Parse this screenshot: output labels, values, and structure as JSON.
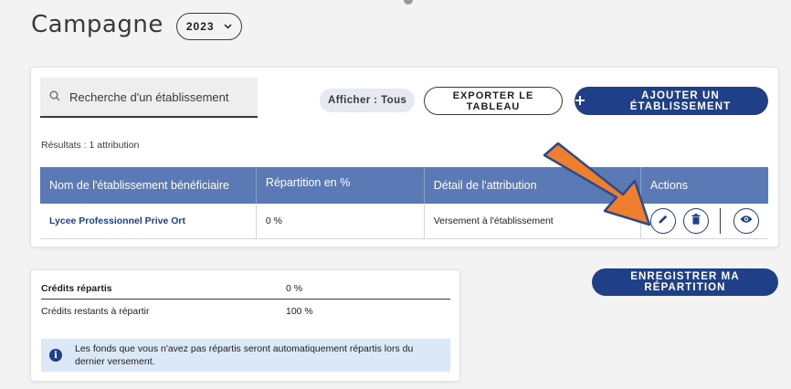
{
  "header": {
    "title": "Campagne",
    "year": "2023",
    "year_chevron": "⌄"
  },
  "toolbar": {
    "search_placeholder": "Recherche d'un établissement",
    "filter_label": "Afficher : Tous",
    "export_label": "EXPORTER LE TABLEAU",
    "add_label": "AJOUTER UN ÉTABLISSEMENT",
    "add_icon": "plus"
  },
  "results_text": "Résultats : 1 attribution",
  "table": {
    "columns": [
      "Nom de l'établissement bénéficiaire",
      "Répartition en %",
      "Détail de l'attribution",
      "Actions"
    ],
    "rows": [
      {
        "name": "Lycee Professionnel Prive Ort",
        "repartition": "0 %",
        "detail": "Versement à l'établissement",
        "actions": [
          "edit-icon",
          "trash-icon",
          "eye-icon"
        ]
      }
    ]
  },
  "credits": {
    "rows": [
      {
        "label": "Crédits répartis",
        "value": "0 %"
      },
      {
        "label": "Crédits restants à répartir",
        "value": "100 %"
      }
    ],
    "info_text": "Les fonds que vous n'avez pas répartis seront automatiquement répartis lors du dernier versement."
  },
  "save_label": "ENREGISTRER MA RÉPARTITION",
  "colors": {
    "primary": "#1f3f86",
    "table_header": "#5b79b5",
    "arrow": "#f07f2d",
    "info_bg": "#dbe8f7"
  }
}
